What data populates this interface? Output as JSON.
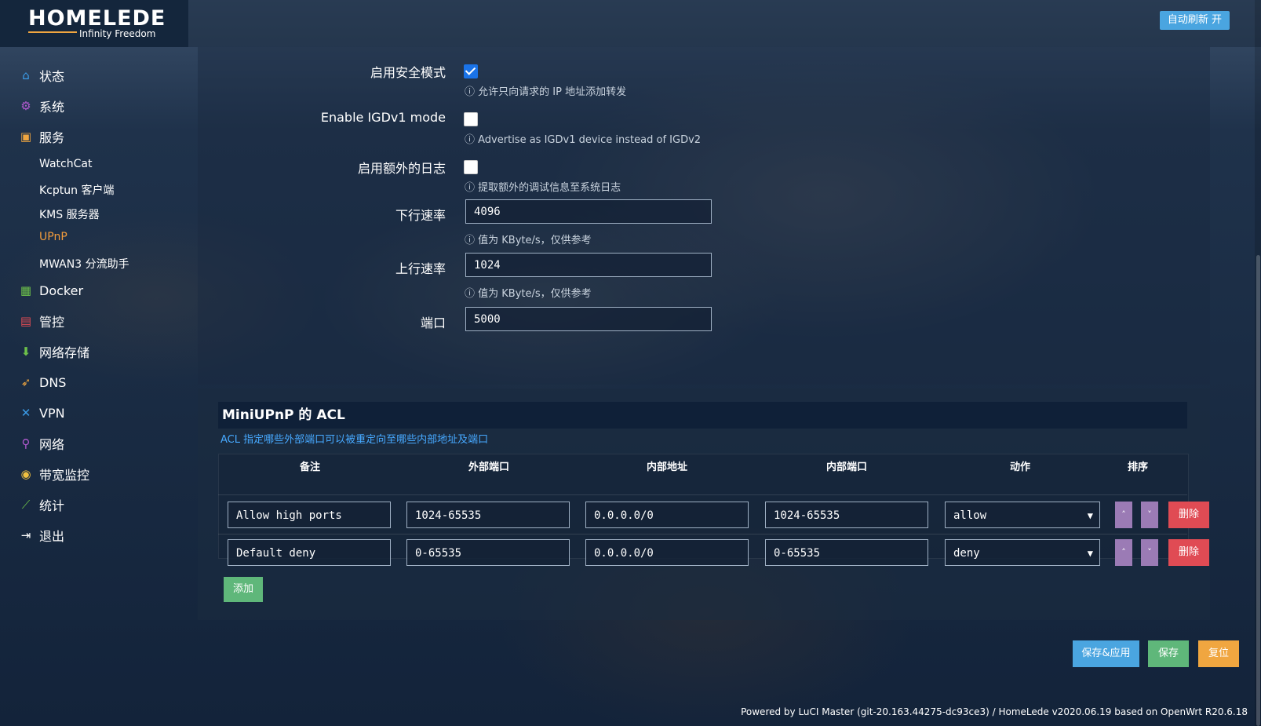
{
  "header": {
    "logo_main": "HOMELEDE",
    "logo_sub": "Infinity Freedom",
    "refresh_label": "自动刷新 开"
  },
  "sidebar": {
    "items": [
      {
        "label": "状态",
        "icon": "home-icon",
        "color": "#3b9ce8"
      },
      {
        "label": "系统",
        "icon": "gear-icon",
        "color": "#b25ad0"
      },
      {
        "label": "服务",
        "icon": "services-icon",
        "color": "#f0a640"
      },
      {
        "label": "Docker",
        "icon": "docker-icon",
        "color": "#6cc04a"
      },
      {
        "label": "管控",
        "icon": "calendar-icon",
        "color": "#e04b54"
      },
      {
        "label": "网络存储",
        "icon": "storage-icon",
        "color": "#6cc04a"
      },
      {
        "label": "DNS",
        "icon": "rocket-icon",
        "color": "#f0a640"
      },
      {
        "label": "VPN",
        "icon": "vpn-icon",
        "color": "#3b9ce8"
      },
      {
        "label": "网络",
        "icon": "network-icon",
        "color": "#b25ad0"
      },
      {
        "label": "带宽监控",
        "icon": "bandwidth-icon",
        "color": "#f0c040"
      },
      {
        "label": "统计",
        "icon": "chart-icon",
        "color": "#6cc04a"
      },
      {
        "label": "退出",
        "icon": "logout-icon",
        "color": "#ffffff"
      }
    ],
    "subitems": [
      {
        "label": "WatchCat"
      },
      {
        "label": "Kcptun 客户端"
      },
      {
        "label": "KMS 服务器"
      },
      {
        "label": "UPnP",
        "active": true
      },
      {
        "label": "MWAN3 分流助手"
      }
    ]
  },
  "settings": {
    "secure_mode_label": "启用安全模式",
    "secure_mode_checked": true,
    "secure_mode_hint": "允许只向请求的 IP 地址添加转发",
    "igdv1_label": "Enable IGDv1 mode",
    "igdv1_checked": false,
    "igdv1_hint": "Advertise as IGDv1 device instead of IGDv2",
    "extra_log_label": "启用额外的日志",
    "extra_log_checked": false,
    "extra_log_hint": "提取额外的调试信息至系统日志",
    "download_label": "下行速率",
    "download_value": "4096",
    "download_hint": "值为 KByte/s，仅供参考",
    "upload_label": "上行速率",
    "upload_value": "1024",
    "upload_hint": "值为 KByte/s，仅供参考",
    "port_label": "端口",
    "port_value": "5000"
  },
  "acl": {
    "title": "MiniUPnP 的 ACL",
    "description": "ACL 指定哪些外部端口可以被重定向至哪些内部地址及端口",
    "columns": [
      "备注",
      "外部端口",
      "内部地址",
      "内部端口",
      "动作",
      "排序"
    ],
    "rows": [
      {
        "comment": "Allow high ports",
        "ext_port": "1024-65535",
        "int_addr": "0.0.0.0/0",
        "int_port": "1024-65535",
        "action": "allow"
      },
      {
        "comment": "Default deny",
        "ext_port": "0-65535",
        "int_addr": "0.0.0.0/0",
        "int_port": "0-65535",
        "action": "deny"
      }
    ],
    "up_glyph": "˄",
    "down_glyph": "˅",
    "delete_label": "删除",
    "add_label": "添加"
  },
  "footer": {
    "save_apply_label": "保存&应用",
    "save_label": "保存",
    "reset_label": "复位",
    "save_apply_color": "#4aa5e0",
    "save_color": "#5fb77a",
    "reset_color": "#f0a640",
    "powered_by": "Powered by LuCI Master (git-20.163.44275-dc93ce3) / HomeLede v2020.06.19 based on OpenWrt R20.6.18"
  }
}
